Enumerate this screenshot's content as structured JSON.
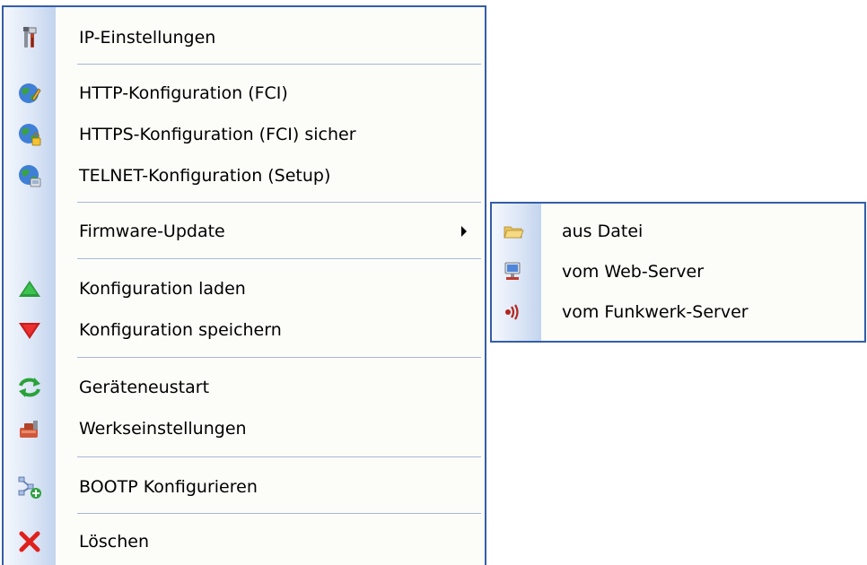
{
  "menu": {
    "items": [
      {
        "label": "IP-Einstellungen",
        "icon": "tools-icon"
      },
      {
        "label": "HTTP-Konfiguration (FCI)",
        "icon": "globe-pencil-icon"
      },
      {
        "label": "HTTPS-Konfiguration (FCI) sicher",
        "icon": "globe-lock-icon"
      },
      {
        "label": "TELNET-Konfiguration (Setup)",
        "icon": "globe-console-icon"
      },
      {
        "label": "Firmware-Update",
        "icon": "none",
        "has_submenu": true
      },
      {
        "label": "Konfiguration laden",
        "icon": "triangle-up-icon"
      },
      {
        "label": "Konfiguration speichern",
        "icon": "triangle-down-icon"
      },
      {
        "label": "Geräteneustart",
        "icon": "refresh-arrows-icon"
      },
      {
        "label": "Werkseinstellungen",
        "icon": "factory-reset-icon"
      },
      {
        "label": "BOOTP Konfigurieren",
        "icon": "network-add-icon"
      },
      {
        "label": "Löschen",
        "icon": "red-x-icon"
      }
    ]
  },
  "submenu": {
    "items": [
      {
        "label": "aus Datei",
        "icon": "folder-icon"
      },
      {
        "label": "vom Web-Server",
        "icon": "web-server-icon"
      },
      {
        "label": "vom Funkwerk-Server",
        "icon": "funkwerk-logo-icon"
      }
    ]
  },
  "colors": {
    "menu_border": "#345ea8",
    "menu_background": "#fcfcf9",
    "gutter_gradient_end": "#c3d4ee",
    "separator": "#a7b6cf"
  }
}
